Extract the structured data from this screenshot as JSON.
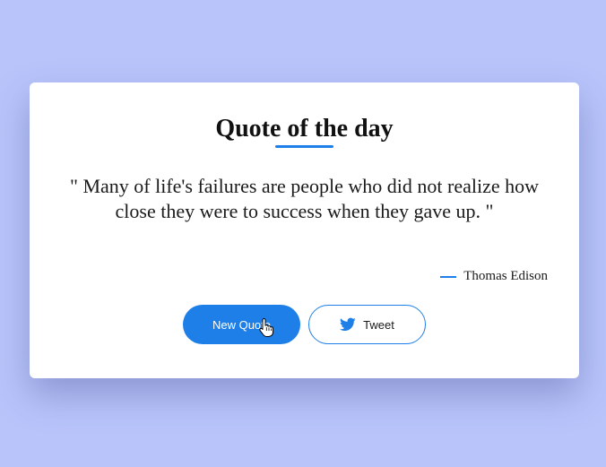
{
  "card": {
    "title": "Quote of the day",
    "quote": "\" Many of life's failures are people who did not realize how close they were to success when they gave up. \"",
    "author": "Thomas Edison"
  },
  "buttons": {
    "new_quote_label": "New Quote",
    "tweet_label": "Tweet"
  },
  "icons": {
    "tweet_icon": "twitter-bird-icon",
    "cursor": "hand-pointer-icon"
  },
  "colors": {
    "background": "#b8c4fa",
    "accent": "#1e7fe8",
    "card": "#ffffff"
  }
}
